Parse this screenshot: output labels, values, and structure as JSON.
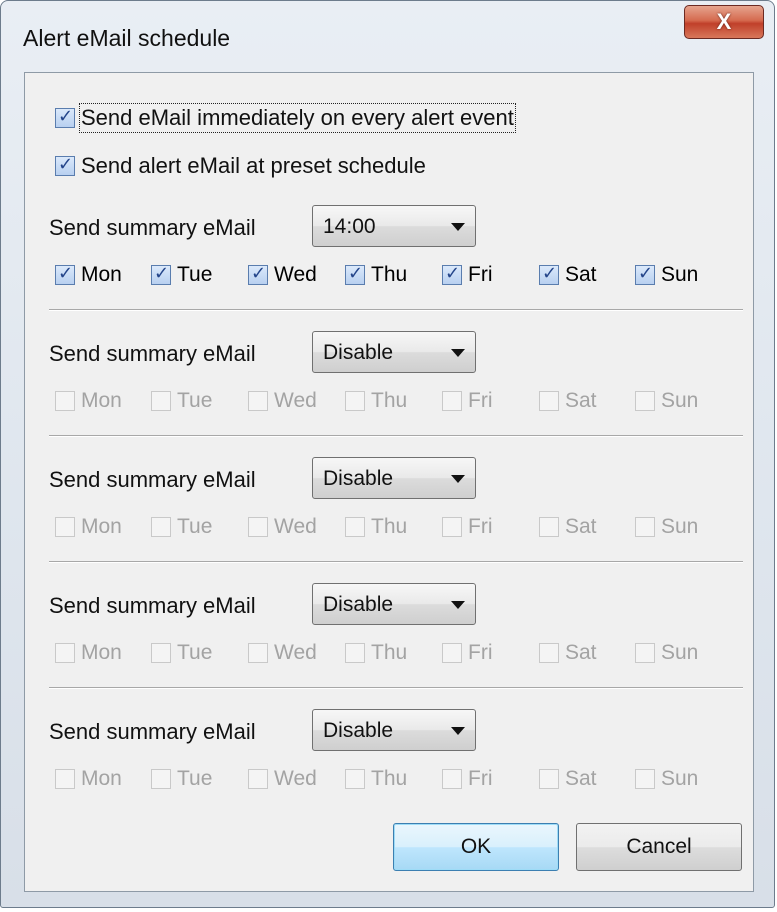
{
  "window": {
    "title": "Alert eMail schedule",
    "close_glyph": "X"
  },
  "options": {
    "immediate_label": "Send eMail immediately on every alert event",
    "immediate_checked": true,
    "preset_label": "Send alert eMail at preset schedule",
    "preset_checked": true
  },
  "schedules": [
    {
      "label": "Send summary eMail",
      "value": "14:00",
      "enabled": true,
      "days": [
        "Mon",
        "Tue",
        "Wed",
        "Thu",
        "Fri",
        "Sat",
        "Sun"
      ],
      "checked": [
        true,
        true,
        true,
        true,
        true,
        true,
        true
      ]
    },
    {
      "label": "Send summary eMail",
      "value": "Disable",
      "enabled": false,
      "days": [
        "Mon",
        "Tue",
        "Wed",
        "Thu",
        "Fri",
        "Sat",
        "Sun"
      ],
      "checked": [
        false,
        false,
        false,
        false,
        false,
        false,
        false
      ]
    },
    {
      "label": "Send summary eMail",
      "value": "Disable",
      "enabled": false,
      "days": [
        "Mon",
        "Tue",
        "Wed",
        "Thu",
        "Fri",
        "Sat",
        "Sun"
      ],
      "checked": [
        false,
        false,
        false,
        false,
        false,
        false,
        false
      ]
    },
    {
      "label": "Send summary eMail",
      "value": "Disable",
      "enabled": false,
      "days": [
        "Mon",
        "Tue",
        "Wed",
        "Thu",
        "Fri",
        "Sat",
        "Sun"
      ],
      "checked": [
        false,
        false,
        false,
        false,
        false,
        false,
        false
      ]
    },
    {
      "label": "Send summary eMail",
      "value": "Disable",
      "enabled": false,
      "days": [
        "Mon",
        "Tue",
        "Wed",
        "Thu",
        "Fri",
        "Sat",
        "Sun"
      ],
      "checked": [
        false,
        false,
        false,
        false,
        false,
        false,
        false
      ]
    }
  ],
  "buttons": {
    "ok_label": "OK",
    "cancel_label": "Cancel"
  },
  "icons": {
    "close": "close-icon",
    "dropdown": "chevron-down-icon",
    "check": "checkmark-icon"
  },
  "colors": {
    "accent": "#3c7fb1",
    "close_button": "#c0402a",
    "disabled_text": "#a3a3a3"
  }
}
